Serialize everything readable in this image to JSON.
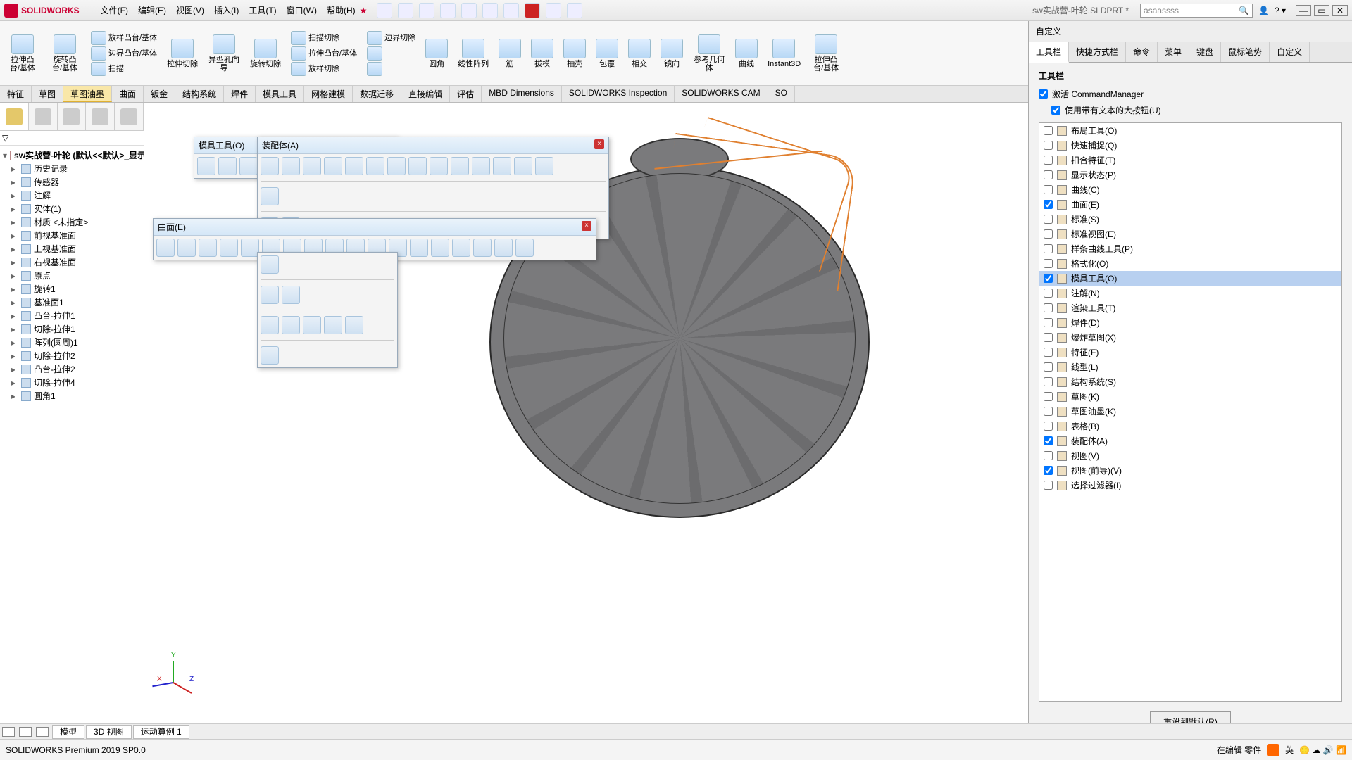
{
  "app": {
    "logo": "SOLIDWORKS",
    "doc": "sw实战营-叶轮.SLDPRT *"
  },
  "search": {
    "placeholder": "asaassss"
  },
  "menu": [
    "文件(F)",
    "编辑(E)",
    "视图(V)",
    "插入(I)",
    "工具(T)",
    "窗口(W)",
    "帮助(H)"
  ],
  "ribbon_groups": [
    {
      "label": "拉伸凸台/基体"
    },
    {
      "label": "旋转凸台/基体"
    },
    {
      "row": [
        "放样凸台/基体",
        "边界凸台/基体",
        "扫描"
      ]
    },
    {
      "label": "拉伸切除"
    },
    {
      "label": "异型孔向导"
    },
    {
      "label": "旋转切除"
    },
    {
      "row": [
        "扫描切除",
        "拉伸凸台/基体",
        "放样切除"
      ]
    },
    {
      "row": [
        "边界切除",
        "",
        ""
      ]
    },
    {
      "label": "圆角"
    },
    {
      "label": "线性阵列"
    },
    {
      "label": "筋"
    },
    {
      "label": "拔模"
    },
    {
      "label": "抽壳"
    },
    {
      "label": "包覆"
    },
    {
      "label": "相交"
    },
    {
      "label": "镜向"
    },
    {
      "label": "参考几何体"
    },
    {
      "label": "曲线"
    },
    {
      "label": "Instant3D"
    },
    {
      "label": "拉伸凸台/基体"
    }
  ],
  "tabs": [
    "特征",
    "草图",
    "草图油墨",
    "曲面",
    "钣金",
    "结构系统",
    "焊件",
    "模具工具",
    "网格建模",
    "数据迁移",
    "直接编辑",
    "评估",
    "MBD Dimensions",
    "SOLIDWORKS Inspection",
    "SOLIDWORKS CAM",
    "SO"
  ],
  "tabs_sel": 2,
  "tree": {
    "root": "sw实战营-叶轮 (默认<<默认>_显示",
    "items": [
      "历史记录",
      "传感器",
      "注解",
      "实体(1)",
      "材质 <未指定>",
      "前视基准面",
      "上视基准面",
      "右视基准面",
      "原点",
      "旋转1",
      "基准面1",
      "凸台-拉伸1",
      "切除-拉伸1",
      "阵列(圆周)1",
      "切除-拉伸2",
      "凸台-拉伸2",
      "切除-拉伸4",
      "圆角1"
    ]
  },
  "float": {
    "mold": "模具工具(O)",
    "assy": "装配体(A)",
    "surf": "曲面(E)"
  },
  "cust": {
    "title": "自定义",
    "tabs": [
      "工具栏",
      "快捷方式栏",
      "命令",
      "菜单",
      "键盘",
      "鼠标笔势",
      "自定义"
    ],
    "section": "工具栏",
    "chk1": "激活 CommandManager",
    "chk2": "使用带有文本的大按钮(U)",
    "list": [
      {
        "l": "布局工具(O)",
        "c": false
      },
      {
        "l": "快速捕捉(Q)",
        "c": false
      },
      {
        "l": "扣合特征(T)",
        "c": false
      },
      {
        "l": "显示状态(P)",
        "c": false
      },
      {
        "l": "曲线(C)",
        "c": false
      },
      {
        "l": "曲面(E)",
        "c": true
      },
      {
        "l": "标准(S)",
        "c": false
      },
      {
        "l": "标准视图(E)",
        "c": false
      },
      {
        "l": "样条曲线工具(P)",
        "c": false
      },
      {
        "l": "格式化(O)",
        "c": false
      },
      {
        "l": "模具工具(O)",
        "c": true,
        "sel": true
      },
      {
        "l": "注解(N)",
        "c": false
      },
      {
        "l": "渲染工具(T)",
        "c": false
      },
      {
        "l": "焊件(D)",
        "c": false
      },
      {
        "l": "爆炸草图(X)",
        "c": false
      },
      {
        "l": "特征(F)",
        "c": false
      },
      {
        "l": "线型(L)",
        "c": false
      },
      {
        "l": "结构系统(S)",
        "c": false
      },
      {
        "l": "草图(K)",
        "c": false
      },
      {
        "l": "草图油墨(K)",
        "c": false
      },
      {
        "l": "表格(B)",
        "c": false
      },
      {
        "l": "装配体(A)",
        "c": true
      },
      {
        "l": "视图(V)",
        "c": false
      },
      {
        "l": "视图(前导)(V)",
        "c": true
      },
      {
        "l": "选择过滤器(I)",
        "c": false
      }
    ],
    "reset": "重设到默认(R)"
  },
  "bottom_tabs": [
    "模型",
    "3D 视图",
    "运动算例 1"
  ],
  "status": {
    "left": "SOLIDWORKS Premium 2019 SP0.0",
    "mode": "在编辑 零件",
    "ime": "英"
  }
}
